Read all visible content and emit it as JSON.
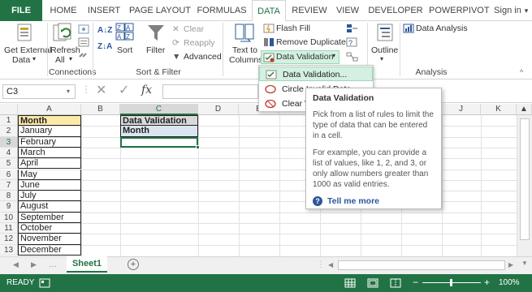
{
  "tabs": [
    "FILE",
    "HOME",
    "INSERT",
    "PAGE LAYOUT",
    "FORMULAS",
    "DATA",
    "REVIEW",
    "VIEW",
    "DEVELOPER",
    "POWERPIVOT",
    "Sign in"
  ],
  "ribbon": {
    "get_external_1": "Get External",
    "get_external_2": "Data",
    "refresh_1": "Refresh",
    "refresh_2": "All",
    "sort": "Sort",
    "filter": "Filter",
    "clear": "Clear",
    "reapply": "Reapply",
    "advanced": "Advanced",
    "text_to_1": "Text to",
    "text_to_2": "Columns",
    "flash_fill": "Flash Fill",
    "remove_duplicates": "Remove Duplicates",
    "data_validation": "Data Validation",
    "outline": "Outline",
    "data_analysis": "Data Analysis",
    "groups": {
      "connections": "Connections",
      "sort_filter": "Sort & Filter",
      "analysis": "Analysis"
    }
  },
  "formula_bar": {
    "name_box": "C3",
    "fx": "fx",
    "value": ""
  },
  "columns": [
    "A",
    "B",
    "C",
    "D",
    "E",
    "F",
    "G",
    "H",
    "I",
    "J",
    "K"
  ],
  "rows": [
    "1",
    "2",
    "3",
    "4",
    "5",
    "6",
    "7",
    "8",
    "9",
    "10",
    "11",
    "12",
    "13"
  ],
  "cells": {
    "A1": "Month",
    "months": [
      "January",
      "February",
      "March",
      "April",
      "May",
      "June",
      "July",
      "August",
      "September",
      "October",
      "November",
      "December"
    ],
    "C1": "Data Validation",
    "C2": "Month"
  },
  "menu": {
    "items": [
      "Data Validation...",
      "Circle Invalid Data",
      "Clear Validation Circles"
    ]
  },
  "tooltip": {
    "title": "Data Validation",
    "p1": "Pick from a list of rules to limit the type of data that can be entered in a cell.",
    "p2": "For example, you can provide a list of values, like 1, 2, and 3, or only allow numbers greater than 1000 as valid entries.",
    "link": "Tell me more"
  },
  "sheets": [
    "Sheet1"
  ],
  "status": {
    "ready": "READY",
    "zoom": "100%"
  },
  "colors": {
    "accent": "#217346",
    "highlight": "#d3f0e0",
    "header_fill": "#fde9a9",
    "c_fill": "#d9d9d9",
    "c2_fill": "#dbe5f1"
  }
}
